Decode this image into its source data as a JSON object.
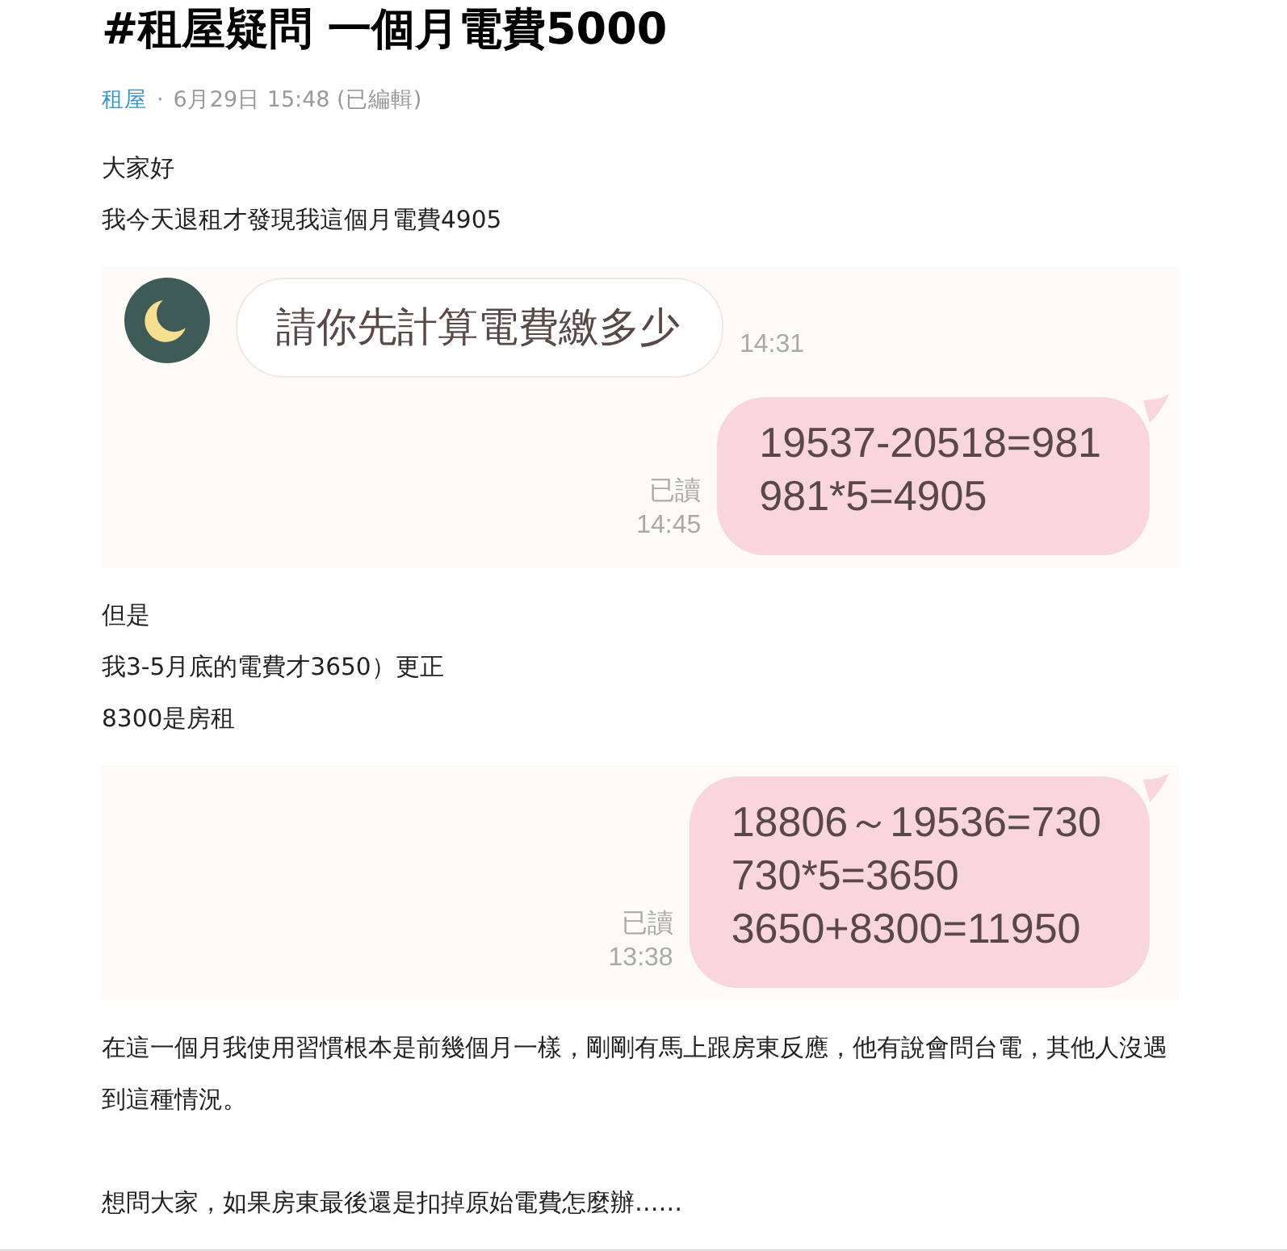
{
  "title": "#租屋疑問 一個月電費5000",
  "meta": {
    "board": "租屋",
    "separator": "·",
    "date": "6月29日 15:48 (已編輯)"
  },
  "body": [
    {
      "kind": "text",
      "lines": [
        "大家好",
        "我今天退租才發現我這個月電費4905"
      ]
    },
    {
      "kind": "chat",
      "messages": [
        {
          "kind": "incoming",
          "lines": [
            "請你先計算電費繳多少"
          ],
          "time": "14:31"
        },
        {
          "kind": "outgoing",
          "lines": [
            "19537-20518=981",
            "981*5=4905"
          ],
          "read": "已讀",
          "time": "14:45"
        }
      ]
    },
    {
      "kind": "text",
      "lines": [
        "但是",
        "我3-5月底的電費才3650）更正",
        "8300是房租"
      ]
    },
    {
      "kind": "chat",
      "messages": [
        {
          "kind": "outgoing",
          "lines": [
            "18806～19536=730",
            "730*5=3650",
            "3650+8300=11950"
          ],
          "read": "已讀",
          "time": "13:38"
        }
      ]
    },
    {
      "kind": "text",
      "lines": [
        "在這一個月我使用習慣根本是前幾個月一樣，剛剛有馬上跟房東反應，他有說會問台電，其他人沒遇到這種情況。"
      ]
    },
    {
      "kind": "text",
      "lines": [
        "想問大家，如果房東最後還是扣掉原始電費怎麼辦……"
      ]
    }
  ]
}
